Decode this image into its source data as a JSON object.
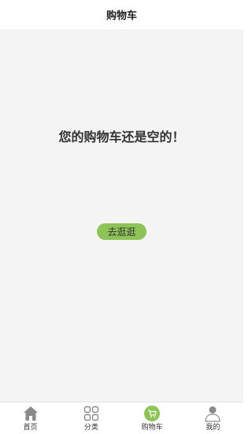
{
  "header": {
    "title": "购物车"
  },
  "main": {
    "empty_message": "您的购物车还是空的！",
    "go_shopping_label": "去逛逛"
  },
  "tabbar": {
    "items": [
      {
        "label": "首页",
        "icon": "home-icon"
      },
      {
        "label": "分类",
        "icon": "grid-icon"
      },
      {
        "label": "购物车",
        "icon": "cart-icon",
        "active": true
      },
      {
        "label": "我的",
        "icon": "user-icon"
      }
    ]
  },
  "colors": {
    "accent": "#8dc357",
    "icon_gray": "#8a8a8a",
    "background": "#f4f4f4"
  }
}
